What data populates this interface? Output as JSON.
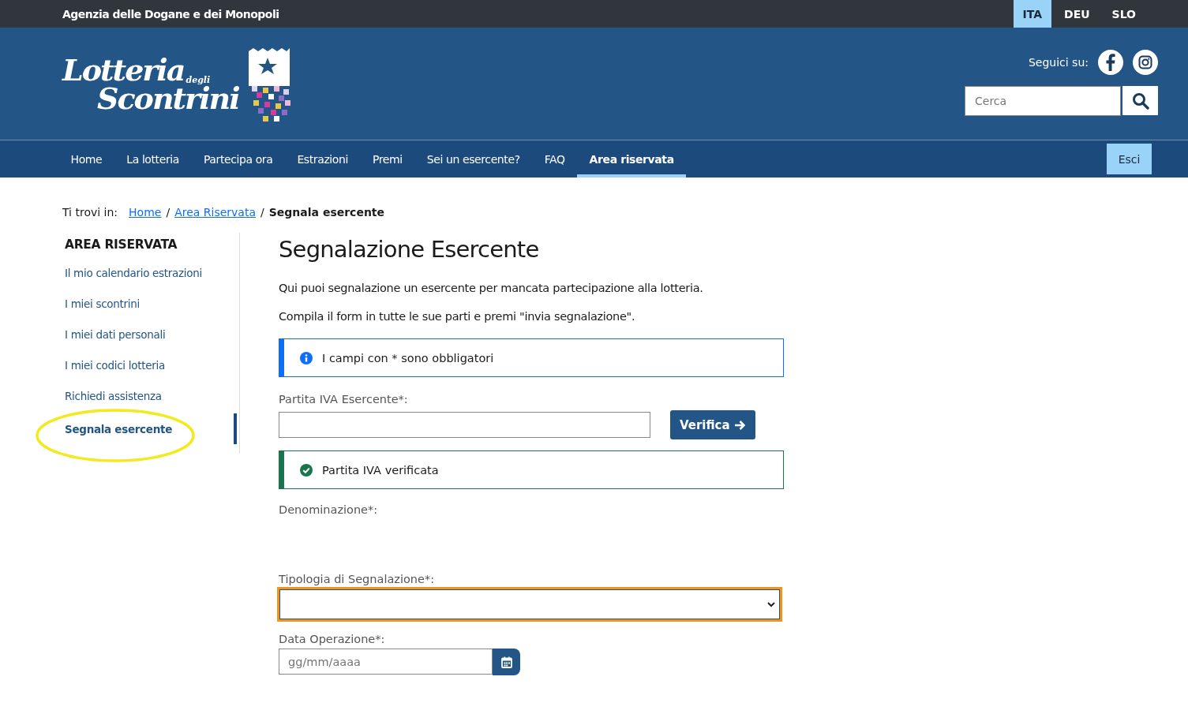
{
  "top_bar": {
    "agency": "Agenzia delle Dogane e dei Monopoli",
    "languages": [
      {
        "label": "ITA",
        "selected": true
      },
      {
        "label": "DEU",
        "selected": false
      },
      {
        "label": "SLO",
        "selected": false
      }
    ]
  },
  "header": {
    "logo": {
      "line_1": "Lotteria",
      "small": "degli",
      "line_2": "Scontrini"
    },
    "follow_label": "Seguici su:",
    "search": {
      "placeholder": "Cerca"
    }
  },
  "nav": {
    "items": [
      {
        "label": "Home",
        "selected": false
      },
      {
        "label": "La lotteria",
        "selected": false
      },
      {
        "label": "Partecipa ora",
        "selected": false
      },
      {
        "label": "Estrazioni",
        "selected": false
      },
      {
        "label": "Premi",
        "selected": false
      },
      {
        "label": "Sei un esercente?",
        "selected": false
      },
      {
        "label": "FAQ",
        "selected": false
      },
      {
        "label": "Area riservata",
        "selected": true
      }
    ],
    "logout": "Esci"
  },
  "breadcrumb": {
    "label": "Ti trovi in:",
    "links": [
      "Home",
      "Area Riservata"
    ],
    "separator": "/",
    "current": "Segnala esercente"
  },
  "sidebar": {
    "title": "AREA RISERVATA",
    "items": [
      {
        "label": "Il mio calendario estrazioni",
        "selected": false
      },
      {
        "label": "I miei scontrini",
        "selected": false
      },
      {
        "label": "I miei dati personali",
        "selected": false
      },
      {
        "label": "I miei codici lotteria",
        "selected": false
      },
      {
        "label": "Richiedi assistenza",
        "selected": false
      },
      {
        "label": "Segnala esercente",
        "selected": true
      }
    ]
  },
  "main": {
    "title": "Segnalazione Esercente",
    "paragraphs": [
      "Qui puoi segnalazione un esercente per mancata partecipazione alla lotteria.",
      "Compila il form in tutte le sue parti e premi \"invia segnalazione\"."
    ],
    "info_alert": {
      "kind": "info",
      "text": "I campi con * sono obbligatori"
    },
    "vat_label": "Partita IVA Esercente*:",
    "verify_button": "Verifica",
    "success_alert": {
      "kind": "success",
      "text": "Partita IVA verificata"
    },
    "name_label": "Denominazione*:",
    "type_label": "Tipologia di Segnalazione*:",
    "date_label": "Data Operazione*:",
    "date_placeholder": "gg/mm/aaaa"
  }
}
